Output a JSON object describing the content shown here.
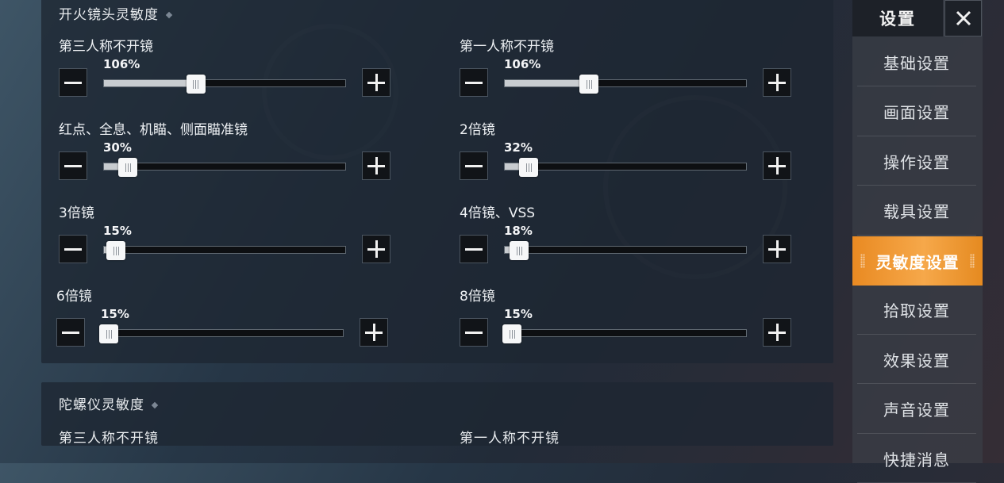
{
  "sections": {
    "fire_scope": {
      "title": "开火镜头灵敏度",
      "settings": [
        {
          "label": "第三人称不开镜",
          "value": "106%",
          "level": 0.38
        },
        {
          "label": "第一人称不开镜",
          "value": "106%",
          "level": 0.35
        },
        {
          "label": "红点、全息、机瞄、侧面瞄准镜",
          "value": "30%",
          "level": 0.1
        },
        {
          "label": "2倍镜",
          "value": "32%",
          "level": 0.1
        },
        {
          "label": "3倍镜",
          "value": "15%",
          "level": 0.05
        },
        {
          "label": "4倍镜、VSS",
          "value": "18%",
          "level": 0.06
        },
        {
          "label": "6倍镜",
          "value": "15%",
          "level": 0.03
        },
        {
          "label": "8倍镜",
          "value": "15%",
          "level": 0.03
        }
      ]
    },
    "gyro": {
      "title": "陀螺仪灵敏度",
      "labels": [
        "第三人称不开镜",
        "第一人称不开镜"
      ]
    }
  },
  "sidebar": {
    "title": "设置",
    "items": [
      {
        "label": "基础设置"
      },
      {
        "label": "画面设置"
      },
      {
        "label": "操作设置"
      },
      {
        "label": "载具设置"
      },
      {
        "label": "灵敏度设置",
        "active": true
      },
      {
        "label": "拾取设置"
      },
      {
        "label": "效果设置"
      },
      {
        "label": "声音设置"
      },
      {
        "label": "快捷消息"
      }
    ]
  },
  "colors": {
    "accent": "#f09a35",
    "panel": "#1e2632"
  }
}
